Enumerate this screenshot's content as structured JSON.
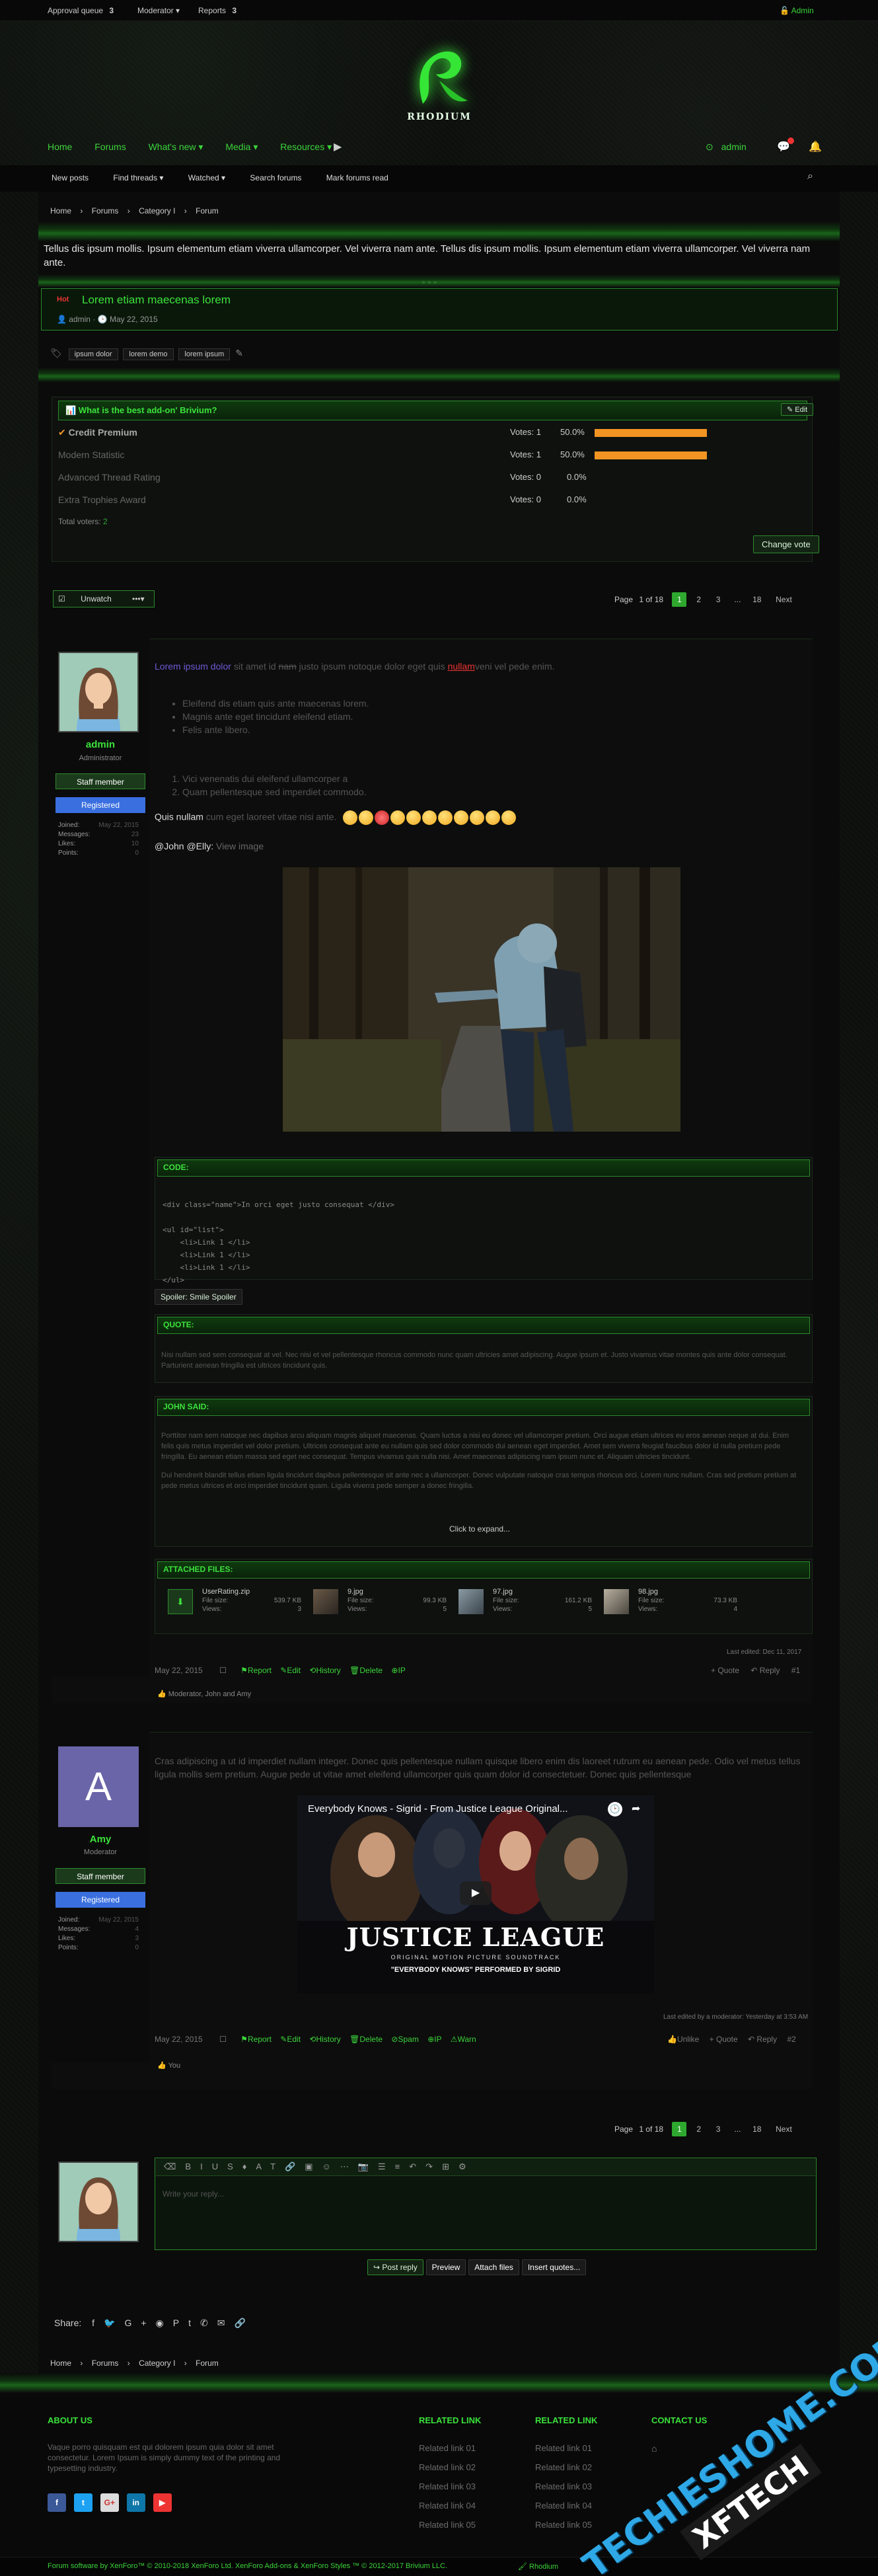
{
  "topbar": {
    "approval_label": "Approval queue",
    "approval_count": "3",
    "moderator_label": "Moderator",
    "reports_label": "Reports",
    "reports_count": "3",
    "admin_label": "Admin"
  },
  "logo": {
    "text": "RHODIUM"
  },
  "nav": {
    "home": "Home",
    "forums": "Forums",
    "whats_new": "What's new",
    "media": "Media",
    "resources": "Resources",
    "user": "admin"
  },
  "subnav": {
    "new_posts": "New posts",
    "find_threads": "Find threads",
    "watched": "Watched",
    "search_forums": "Search forums",
    "mark_read": "Mark forums read"
  },
  "breadcrumb": {
    "home": "Home",
    "forums": "Forums",
    "category": "Category I",
    "forum": "Forum"
  },
  "notice": {
    "text": "Tellus dis ipsum mollis. Ipsum elementum etiam viverra ullamcorper. Vel viverra nam ante. Tellus dis ipsum mollis. Ipsum elementum etiam viverra ullamcorper. Vel viverra nam ante."
  },
  "thread": {
    "prefix": "Hot",
    "title": "Lorem etiam maecenas lorem",
    "author": "admin",
    "date": "May 22, 2015",
    "tags": [
      "ipsum dolor",
      "lorem demo",
      "lorem ipsum"
    ]
  },
  "poll": {
    "question": "What is the best add-on' Brivium?",
    "edit": "Edit",
    "options": [
      {
        "label": "Credit Premium",
        "votes": "Votes: 1",
        "pct": "50.0%",
        "value": 0.5,
        "voted": true
      },
      {
        "label": "Modern Statistic",
        "votes": "Votes: 1",
        "pct": "50.0%",
        "value": 0.5,
        "voted": false
      },
      {
        "label": "Advanced Thread Rating",
        "votes": "Votes: 0",
        "pct": "0.0%",
        "value": 0,
        "voted": false
      },
      {
        "label": "Extra Trophies Award",
        "votes": "Votes: 0",
        "pct": "0.0%",
        "value": 0,
        "voted": false
      }
    ],
    "total_label": "Total voters:",
    "total": "2",
    "change_vote": "Change vote"
  },
  "controls": {
    "unwatch": "Unwatch",
    "more": "•••"
  },
  "pagination": {
    "label": "Page",
    "of": "1 of 18",
    "pages": [
      "1",
      "2",
      "3",
      "...",
      "18"
    ],
    "next": "Next"
  },
  "post1": {
    "user": "admin",
    "role": "Administrator",
    "badge1": "Staff member",
    "badge2": "Registered",
    "stats": [
      {
        "k": "Joined:",
        "v": "May 22, 2015"
      },
      {
        "k": "Messages:",
        "v": "23"
      },
      {
        "k": "Likes:",
        "v": "10"
      },
      {
        "k": "Points:",
        "v": "0"
      }
    ],
    "intro_a": "Lorem ipsum dolor",
    "intro_b": " sit amet id ",
    "intro_c": "nam",
    "intro_d": " justo ipsum notoque dolor eget quis ",
    "intro_e": "nullam",
    "intro_f": "veni vel pede enim.",
    "bullets": [
      "Eleifend dis etiam quis ante maecenas lorem.",
      "Magnis ante eget tincidunt eleifend etiam.",
      "Felis ante libero."
    ],
    "ordered": [
      "Vici venenatis dui eleifend ullamcorper a",
      "Quam pellentesque sed imperdiet commodo."
    ],
    "quis_a": "Quis nullam",
    "quis_b": " cum eget laoreet vitae nisi ante.",
    "mention": "@John @Elly: ",
    "view_image": "View image",
    "code_title": "CODE:",
    "code_lines": [
      "<div class=\"name\">In orci eget justo consequat </div>",
      "",
      "<ul id=\"list\">",
      "    <li>Link 1 </li>",
      "    <li>Link 1 </li>",
      "    <li>Link 1 </li>",
      "</ul>"
    ],
    "spoiler": "Spoiler: Smile Spoiler",
    "quote_title": "QUOTE:",
    "quote_text": "Nisi nullam sed sem consequat at vel. Nec nisi et vel pellentesque rhoncus commodo nunc quam ultricies amet adipiscing. Augue ipsum et. Justo vivamus vitae montes quis ante dolor consequat. Parturient aenean fringilla est ultrices tincidunt quis.",
    "said_title": "JOHN SAID:",
    "said_text1": "Porttitor nam sem natoque nec dapibus arcu aliquam magnis aliquet maecenas. Quam luctus a nisi eu donec vel ullamcorper pretium. Orci augue etiam ultrices eu eros aenean neque at dui. Enim felis quis metus imperdiet vel dolor pretium. Ultrices consequat ante eu nullam quis sed dolor commodo dui aenean eget imperdiet. Amet sem viverra feugiat faucibus dolor id nulla pretium pede fringilla. Eu aenean etiam massa sed eget nec consequat. Tempus vivamus quis nulla nisi. Amet maecenas adipiscing nam ipsum nunc et. Aliquam ultricies tincidunt.",
    "said_text2": "Dui hendrerit blandit tellus etiam ligula tincidunt dapibus pellentesque sit ante nec a ullamcorper. Donec vulputate natoque cras tempus rhoncus orci. Lorem nunc nullam. Cras sed pretium pretium at pede metus ultrices et orci imperdiet tincidunt quam. Ligula viverra pede semper a donec fringilla.",
    "expand": "Click to expand...",
    "attach_title": "ATTACHED FILES:",
    "files": [
      {
        "name": "UserRating.zip",
        "size": "539.7 KB",
        "views": "3"
      },
      {
        "name": "9.jpg",
        "size": "99.3 KB",
        "views": "5"
      },
      {
        "name": "97.jpg",
        "size": "161.2 KB",
        "views": "5"
      },
      {
        "name": "98.jpg",
        "size": "73.3 KB",
        "views": "4"
      }
    ],
    "file_size_label": "File size:",
    "views_label": "Views:",
    "edited": "Last edited: Dec 11, 2017",
    "date": "May 22, 2015",
    "actions": [
      "Report",
      "Edit",
      "History",
      "Delete",
      "IP"
    ],
    "right_actions": [
      "+ Quote",
      "Reply",
      "#1"
    ],
    "likes": "Moderator, John and Amy"
  },
  "post2": {
    "user": "Amy",
    "avatar_letter": "A",
    "role": "Moderator",
    "badge1": "Staff member",
    "badge2": "Registered",
    "stats": [
      {
        "k": "Joined:",
        "v": "May 22, 2015"
      },
      {
        "k": "Messages:",
        "v": "4"
      },
      {
        "k": "Likes:",
        "v": "3"
      },
      {
        "k": "Points:",
        "v": "0"
      }
    ],
    "text": "Cras adipiscing a ut id imperdiet nullam integer. Donec quis pellentesque nullam quisque libero enim dis laoreet rutrum eu aenean pede. Odio vel metus tellus ligula mollis sem pretium. Augue pede ut vitae amet eleifend ullamcorper quis quam dolor id consectetuer. Donec quis pellentesque",
    "video_title": "Everybody Knows - Sigrid - From Justice League Original...",
    "video_main": "JUSTICE LEAGUE",
    "video_sub": "ORIGINAL MOTION PICTURE SOUNDTRACK",
    "video_song": "\"EVERYBODY KNOWS\" PERFORMED BY SIGRID",
    "edited": "Last edited by a moderator: Yesterday at 3:53 AM",
    "date": "May 22, 2015",
    "actions": [
      "Report",
      "Edit",
      "History",
      "Delete",
      "Spam",
      "IP",
      "Warn"
    ],
    "right_actions": [
      "Unlike",
      "+ Quote",
      "Reply",
      "#2"
    ],
    "likes": "You"
  },
  "reply": {
    "placeholder": "Write your reply...",
    "post": "Post reply",
    "preview": "Preview",
    "attach": "Attach files",
    "insert": "Insert quotes..."
  },
  "share": {
    "label": "Share:"
  },
  "footer": {
    "about_title": "ABOUT US",
    "about_text": "Vaque porro quisquam est qui dolorem ipsum quia dolor sit amet consectetur. Lorem Ipsum is simply dummy text of the printing and typesetting industry.",
    "related1_title": "RELATED LINK",
    "related2_title": "RELATED LINK",
    "contact_title": "CONTACT US",
    "links1": [
      "Related link 01",
      "Related link 02",
      "Related link 03",
      "Related link 04",
      "Related link 05"
    ],
    "links2": [
      "Related link 01",
      "Related link 02",
      "Related link 03",
      "Related link 04",
      "Related link 05"
    ],
    "copyright": "Forum software by XenForo™ © 2010-2018 XenForo Ltd. XenForo Add-ons & XenForo Styles ™ © 2012-2017 Brivium LLC.",
    "style": "Rhodium"
  },
  "watermark": {
    "line1": "TECHIESHOME.COM",
    "line2": "XFTECH"
  },
  "colors": {
    "accent": "#2ea82e",
    "bar": "#f29423",
    "badge_blue": "#3a6fe0"
  }
}
